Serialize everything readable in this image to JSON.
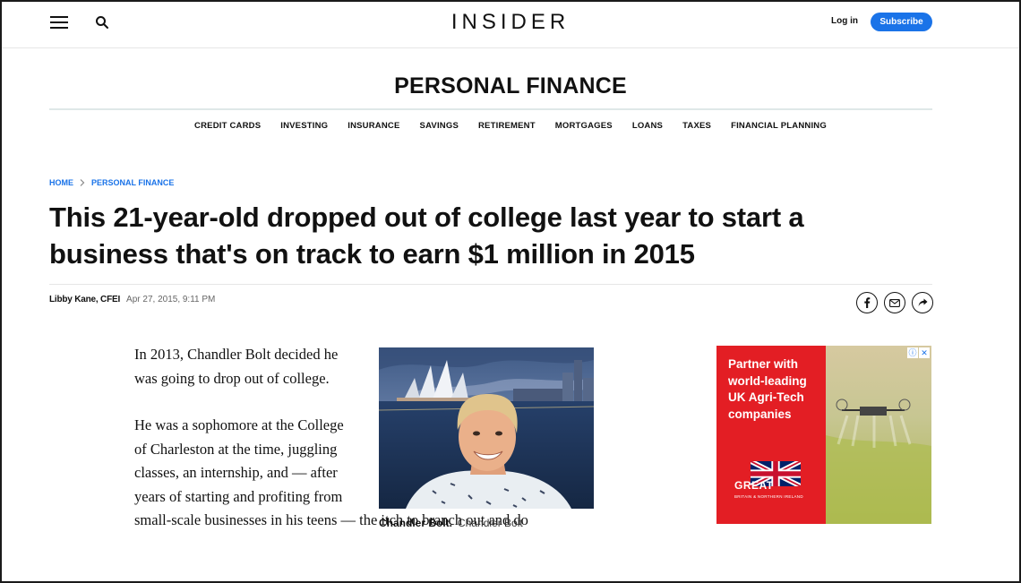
{
  "header": {
    "logo": "INSIDER",
    "login_label": "Log in",
    "subscribe_label": "Subscribe"
  },
  "section": {
    "title": "PERSONAL FINANCE",
    "nav": [
      "CREDIT CARDS",
      "INVESTING",
      "INSURANCE",
      "SAVINGS",
      "RETIREMENT",
      "MORTGAGES",
      "LOANS",
      "TAXES",
      "FINANCIAL PLANNING"
    ]
  },
  "breadcrumb": {
    "home": "HOME",
    "current": "PERSONAL FINANCE"
  },
  "article": {
    "headline": "This 21-year-old dropped out of college last year to start a business that's on track to earn $1 million in 2015",
    "author": "Libby Kane, CFEI",
    "date": "Apr 27, 2015, 9:11 PM",
    "paragraphs": [
      "In 2013, Chandler Bolt decided he was going to drop out of college.",
      "He was a sophomore at the College of Charleston at the time, juggling classes, an internship, and — after years of starting and profiting from",
      "small-scale businesses in his teens — the itch to branch out and do"
    ],
    "figure": {
      "caption": "Chandler Bolt.",
      "credit": "Chandler Bolt"
    }
  },
  "ad": {
    "copy": "Partner with world-leading UK Agri-Tech companies",
    "brand": "GREAT",
    "brand_sub": "BRITAIN & NORTHERN IRELAND"
  },
  "colors": {
    "accent": "#1a73e8",
    "ad_red": "#e31e24",
    "text": "#111111"
  }
}
